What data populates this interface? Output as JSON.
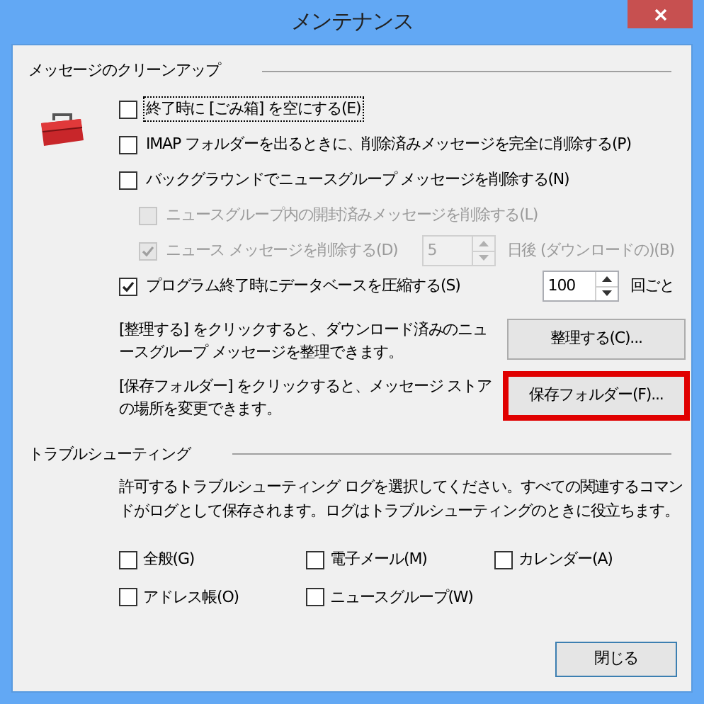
{
  "window": {
    "title": "メンテナンス"
  },
  "cleanup": {
    "label": "メッセージのクリーンアップ",
    "options": [
      {
        "kind": "checkbox",
        "label": "終了時に [ごみ箱] を空にする(E)",
        "checked": false,
        "disabled": false,
        "focused": true
      },
      {
        "kind": "checkbox",
        "label": "IMAP フォルダーを出るときに、削除済みメッセージを完全に削除する(P)",
        "checked": false,
        "disabled": false,
        "focused": false
      },
      {
        "kind": "checkbox",
        "label": "バックグラウンドでニュースグループ メッセージを削除する(N)",
        "checked": false,
        "disabled": false,
        "focused": false,
        "children": [
          {
            "kind": "checkbox",
            "label": "ニュースグループ内の開封済みメッセージを削除する(L)",
            "checked": false,
            "disabled": true,
            "focused": false
          },
          {
            "kind": "spinner",
            "label": "ニュース メッセージを削除する(D)",
            "checked": true,
            "disabled": true,
            "focused": false,
            "value": "5",
            "suffix": "日後 (ダウンロードの)(B)"
          }
        ]
      },
      {
        "kind": "spinner",
        "label": "プログラム終了時にデータベースを圧縮する(S)",
        "checked": true,
        "disabled": false,
        "focused": false,
        "value": "100",
        "suffix": "回ごと"
      }
    ],
    "actions": [
      {
        "description": "[整理する] をクリックすると、ダウンロード済みのニュースグループ メッセージを整理できます。",
        "button": "整理する(C)...",
        "highlighted": false
      },
      {
        "description": "[保存フォルダー] をクリックすると、メッセージ ストアの場所を変更できます。",
        "button": "保存フォルダー(F)...",
        "highlighted": true
      }
    ]
  },
  "troubleshooting": {
    "label": "トラブルシューティング",
    "description": "許可するトラブルシューティング ログを選択してください。すべての関連するコマンドがログとして保存されます。ログはトラブルシューティングのときに役立ちます。",
    "logs": [
      {
        "label": "全般(G)",
        "checked": false
      },
      {
        "label": "電子メール(M)",
        "checked": false
      },
      {
        "label": "カレンダー(A)",
        "checked": false
      },
      {
        "label": "アドレス帳(O)",
        "checked": false
      },
      {
        "label": "ニュースグループ(W)",
        "checked": false
      }
    ]
  },
  "close_button": "閉じる"
}
